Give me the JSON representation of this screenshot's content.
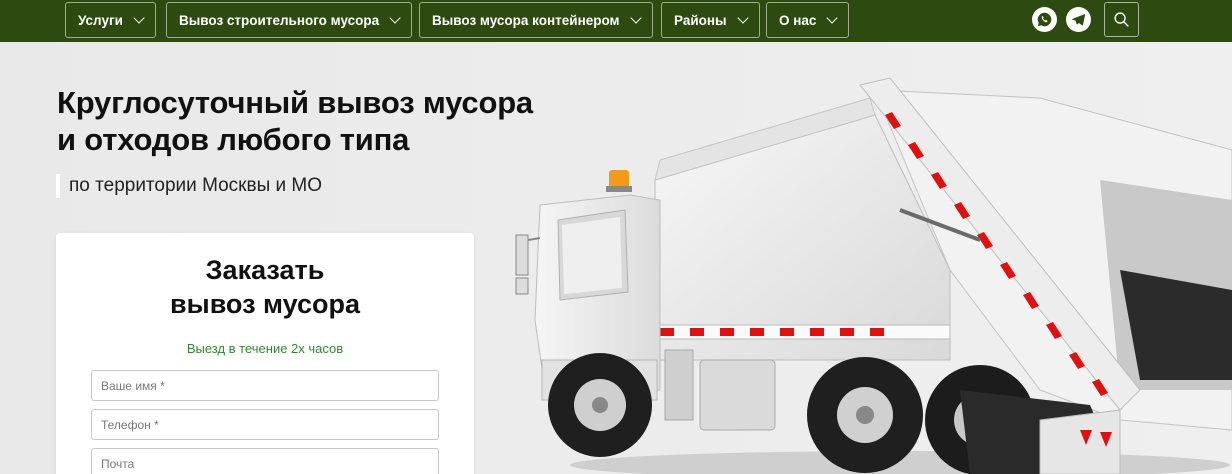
{
  "nav": {
    "items": [
      {
        "label": "Услуги"
      },
      {
        "label": "Вывоз строительного мусора"
      },
      {
        "label": "Вывоз мусора контейнером"
      },
      {
        "label": "Районы"
      },
      {
        "label": "О нас"
      }
    ],
    "icons": [
      "whatsapp-icon",
      "telegram-icon",
      "search-icon"
    ]
  },
  "hero": {
    "title_line1": "Круглосуточный вывоз мусора",
    "title_line2": "и отходов любого типа",
    "subtitle": "по территории Москвы и МО"
  },
  "form": {
    "title_line1": "Заказать",
    "title_line2": "вывоз мусора",
    "note": "Выезд в течение 2х часов",
    "name_placeholder": "Ваше имя *",
    "phone_placeholder": "Телефон *",
    "email_placeholder": "Почта"
  },
  "colors": {
    "nav_bg": "#2d4a10",
    "accent_green": "#2c8a2c",
    "stripe_red": "#e01010"
  }
}
